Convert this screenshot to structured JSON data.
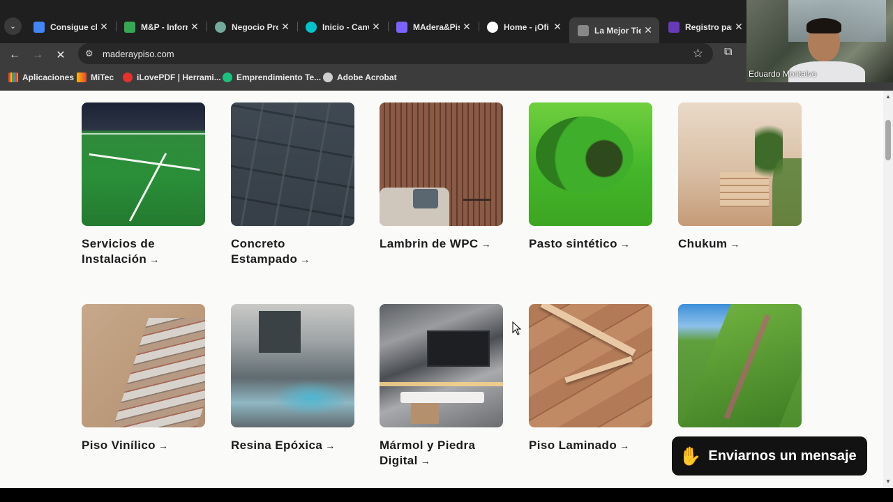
{
  "browser": {
    "tabs": [
      {
        "title": "Consigue cli",
        "favicon_color": "#4285f4",
        "active": false
      },
      {
        "title": "M&P - Inforr",
        "favicon_color": "#34a853",
        "active": false
      },
      {
        "title": "Negocio Pro",
        "favicon_color": "#74aa9c",
        "active": false
      },
      {
        "title": "Inicio - Canv",
        "favicon_color": "#00c4cc",
        "active": false
      },
      {
        "title": "MAdera&Pis",
        "favicon_color": "#7b61ff",
        "active": false
      },
      {
        "title": "Home - ¡Ofi",
        "favicon_color": "#ffffff",
        "active": false
      },
      {
        "title": "La Mejor Tie",
        "favicon_color": "#888888",
        "active": true
      },
      {
        "title": "Registro par",
        "favicon_color": "#673ab7",
        "active": false
      }
    ],
    "close_glyph": "✕",
    "tab_menu_glyph": "⌄",
    "url": "maderaypiso.com",
    "bookmarks": [
      {
        "label": "Aplicaciones",
        "icon": "apps-grid-icon",
        "color": "#ea4335"
      },
      {
        "label": "MiTec",
        "icon": "mitec-icon",
        "color": "#fbbc05"
      },
      {
        "label": "iLovePDF | Herrami...",
        "icon": "ilovepdf-icon",
        "color": "#e5322d"
      },
      {
        "label": "Emprendimiento Te...",
        "icon": "sprout-icon",
        "color": "#19c37d"
      },
      {
        "label": "Adobe Acrobat",
        "icon": "globe-icon",
        "color": "#cfcfcf"
      }
    ]
  },
  "webcam": {
    "name": "Eduardo Montalvo"
  },
  "products_row1": [
    {
      "name": "Servicios de Instalación",
      "image": "soccer-field-turf"
    },
    {
      "name": "Concreto Estampado",
      "image": "stamped-concrete"
    },
    {
      "name": "Lambrin de WPC",
      "image": "wpc-wall-panels"
    },
    {
      "name": "Pasto sintético",
      "image": "synthetic-grass-roll"
    },
    {
      "name": "Chukum",
      "image": "chukum-stairs"
    }
  ],
  "products_row2": [
    {
      "name": "Piso Vinílico",
      "image": "vinyl-planks"
    },
    {
      "name": "Resina Epóxica",
      "image": "epoxy-floor"
    },
    {
      "name": "Mármol y Piedra Digital",
      "image": "marble-tv-wall"
    },
    {
      "name": "Piso Laminado",
      "image": "laminate-floor"
    },
    {
      "name": "",
      "image": "green-wall"
    }
  ],
  "arrow_glyph": "→",
  "chat_widget": {
    "label": "Enviarnos un mensaje",
    "icon": "waving-hand-icon"
  }
}
